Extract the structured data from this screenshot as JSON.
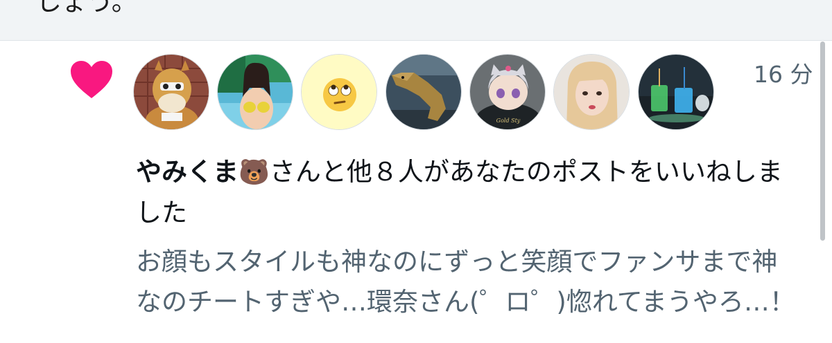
{
  "previous_item": {
    "text_fragment": "しょう。"
  },
  "notification": {
    "type_icon": "heart-icon",
    "accent_color": "#f91880",
    "avatars": [
      {
        "label": "horse-mascot-avatar"
      },
      {
        "label": "swimsuit-photo-avatar"
      },
      {
        "label": "eye-roll-emoji-avatar"
      },
      {
        "label": "dinosaur-avatar"
      },
      {
        "label": "anime-character-avatar"
      },
      {
        "label": "blonde-person-avatar"
      },
      {
        "label": "drinks-avatar"
      }
    ],
    "timestamp": "16 分",
    "actor_name": "やみくま",
    "actor_emoji": "🐻",
    "action_text": "さんと他８人があなたのポストをいいねしました",
    "post_preview": "お顔もスタイルも神なのにずっと笑顔でファンサまで神なのチートすぎや…環奈さん(゜ロ゜)惚れてまうやろ…！"
  }
}
